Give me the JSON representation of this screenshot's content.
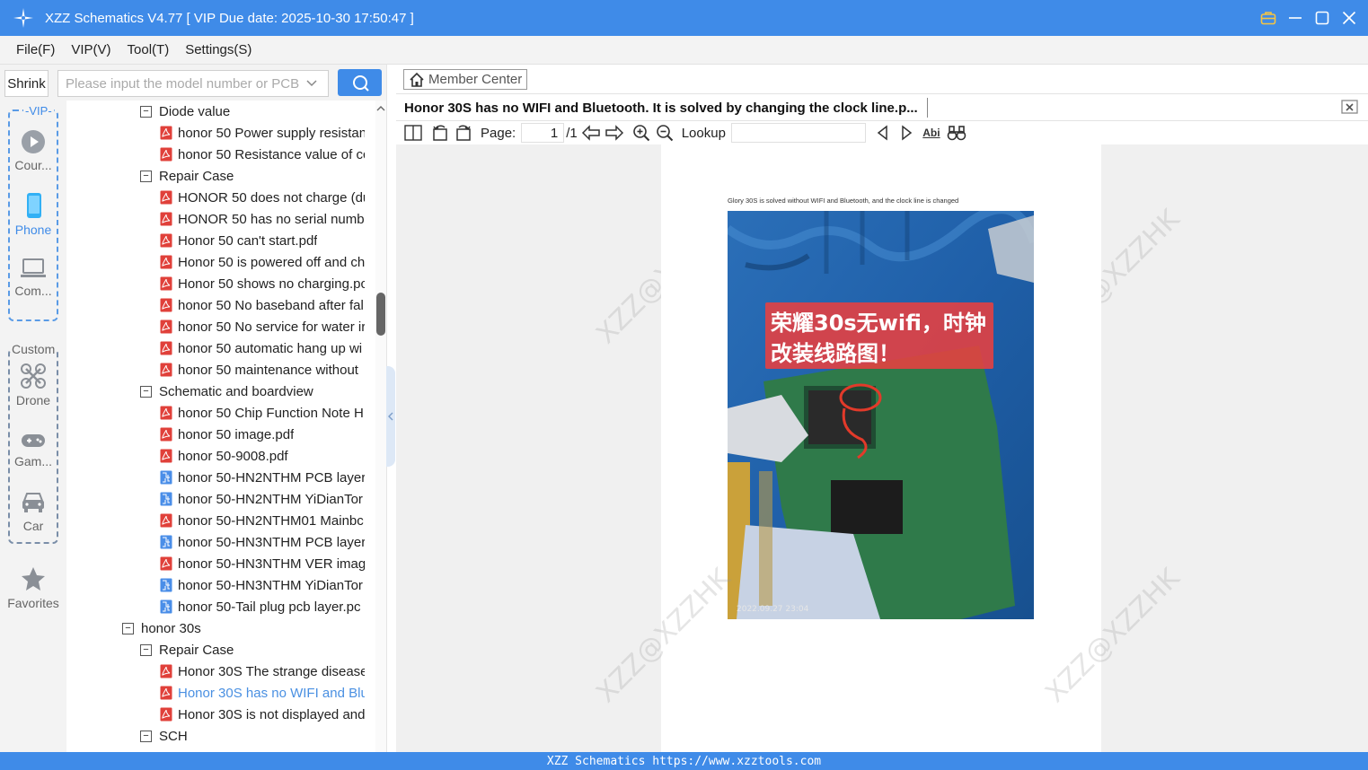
{
  "app": {
    "title": "XZZ Schematics V4.77 [ VIP Due date: 2025-10-30 17:50:47 ]",
    "accent_color": "#3f8be8"
  },
  "menu": [
    "File(F)",
    "VIP(V)",
    "Tool(T)",
    "Settings(S)"
  ],
  "search": {
    "shrink_label": "Shrink",
    "placeholder": "Please input the model number or PCB"
  },
  "categories": {
    "vip_label": "VIP",
    "custom_label": "Custom",
    "items": [
      {
        "label": "Cour...",
        "icon": "play-circle-icon"
      },
      {
        "label": "Phone",
        "icon": "phone-icon",
        "active": true
      },
      {
        "label": "Com...",
        "icon": "laptop-icon"
      },
      {
        "label": "Drone",
        "icon": "drone-icon"
      },
      {
        "label": "Gam...",
        "icon": "gamepad-icon"
      },
      {
        "label": "Car",
        "icon": "car-icon"
      },
      {
        "label": "Favorites",
        "icon": "star-icon"
      }
    ]
  },
  "tree": [
    {
      "type": "folder",
      "level": 2,
      "label": "Diode value"
    },
    {
      "type": "pdf",
      "level": 3,
      "label": "honor 50 Power supply resistan"
    },
    {
      "type": "pdf",
      "level": 3,
      "label": "honor 50 Resistance value of cc"
    },
    {
      "type": "folder",
      "level": 2,
      "label": "Repair Case"
    },
    {
      "type": "pdf",
      "level": 3,
      "label": "HONOR 50 does not charge (du"
    },
    {
      "type": "pdf",
      "level": 3,
      "label": "HONOR 50 has no serial numbe"
    },
    {
      "type": "pdf",
      "level": 3,
      "label": "Honor 50 can't start.pdf"
    },
    {
      "type": "pdf",
      "level": 3,
      "label": "Honor 50 is powered off and ch"
    },
    {
      "type": "pdf",
      "level": 3,
      "label": "Honor 50 shows no charging.pc"
    },
    {
      "type": "pdf",
      "level": 3,
      "label": "honor 50 No baseband after fal"
    },
    {
      "type": "pdf",
      "level": 3,
      "label": "honor 50 No service for water ir"
    },
    {
      "type": "pdf",
      "level": 3,
      "label": "honor 50 automatic hang up wi"
    },
    {
      "type": "pdf",
      "level": 3,
      "label": "honor 50 maintenance without"
    },
    {
      "type": "folder",
      "level": 2,
      "label": "Schematic and boardview"
    },
    {
      "type": "pdf",
      "level": 3,
      "label": "honor 50 Chip Function Note H"
    },
    {
      "type": "pdf",
      "level": 3,
      "label": "honor 50 image.pdf"
    },
    {
      "type": "pdf",
      "level": 3,
      "label": "honor 50-9008.pdf"
    },
    {
      "type": "pcb",
      "level": 3,
      "label": "honor 50-HN2NTHM PCB layer("
    },
    {
      "type": "pcb",
      "level": 3,
      "label": "honor 50-HN2NTHM YiDianTor"
    },
    {
      "type": "pdf",
      "level": 3,
      "label": "honor 50-HN2NTHM01 Mainbc"
    },
    {
      "type": "pcb",
      "level": 3,
      "label": "honor 50-HN3NTHM PCB layer("
    },
    {
      "type": "pdf",
      "level": 3,
      "label": "honor 50-HN3NTHM VER image"
    },
    {
      "type": "pcb",
      "level": 3,
      "label": "honor 50-HN3NTHM YiDianTor"
    },
    {
      "type": "pcb",
      "level": 3,
      "label": "honor 50-Tail plug pcb layer.pc"
    },
    {
      "type": "folder",
      "level": 1,
      "label": "honor 30s"
    },
    {
      "type": "folder",
      "level": 2,
      "label": "Repair Case"
    },
    {
      "type": "pdf",
      "level": 3,
      "label": "Honor 30S The strange disease"
    },
    {
      "type": "pdf",
      "level": 3,
      "label": "Honor 30S has no WIFI and Blu",
      "selected": true
    },
    {
      "type": "pdf",
      "level": 3,
      "label": "Honor 30S is not displayed and"
    },
    {
      "type": "folder",
      "level": 2,
      "label": "SCH"
    }
  ],
  "viewer": {
    "member_center": "Member Center",
    "doc_tab": "Honor 30S has no WIFI and Bluetooth. It is solved by changing the clock line.p...",
    "page_label": "Page:",
    "page_current": "1",
    "page_total": "/1",
    "lookup_label": "Lookup",
    "find_icon_text": "Abi",
    "pdf_caption": "Glory 30S is solved without WIFI and Bluetooth, and the clock line is changed",
    "photo_overlay_line1": "荣耀30s无wifi，时钟",
    "photo_overlay_line2": "改装线路图！",
    "photo_timestamp": "2022.09.27 23:04",
    "watermark": "XZZ@XZZHK"
  },
  "status": {
    "text": "XZZ Schematics https://www.xzztools.com"
  }
}
